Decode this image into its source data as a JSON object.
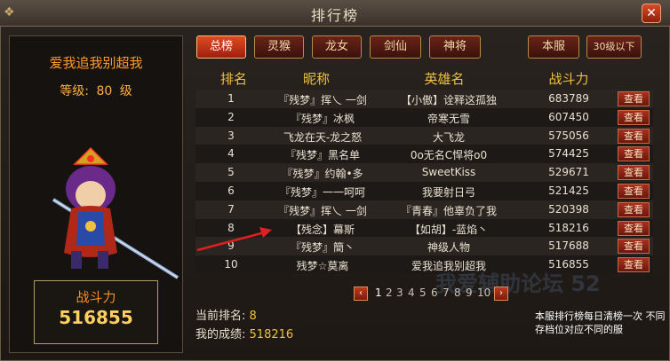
{
  "window": {
    "title": "排行榜",
    "close_label": "✕"
  },
  "hero": {
    "name": "爱我追我别超我",
    "level_label": "等级:",
    "level_value": "80",
    "level_suffix": "级",
    "power_label": "战斗力",
    "power_value": "516855"
  },
  "tabs": [
    {
      "label": "总榜",
      "active": true
    },
    {
      "label": "灵猴",
      "active": false
    },
    {
      "label": "龙女",
      "active": false
    },
    {
      "label": "剑仙",
      "active": false
    },
    {
      "label": "神将",
      "active": false
    },
    {
      "label": "本服",
      "active": false
    },
    {
      "label": "30级以下",
      "active": false
    }
  ],
  "table": {
    "headers": [
      "排名",
      "昵称",
      "英雄名",
      "战斗力"
    ],
    "view_label": "查看",
    "rows": [
      {
        "rank": "1",
        "nick": "『残梦』挥乀 一剑",
        "hero": "【小傲】诠释这孤独",
        "power": "683789"
      },
      {
        "rank": "2",
        "nick": "『残梦』冰枫",
        "hero": "帝寒无雪",
        "power": "607450"
      },
      {
        "rank": "3",
        "nick": "飞龙在天-龙之怒",
        "hero": "大飞龙",
        "power": "575056"
      },
      {
        "rank": "4",
        "nick": "『残梦』黑名单",
        "hero": "0o无名C悍将o0",
        "power": "574425"
      },
      {
        "rank": "5",
        "nick": "『残梦』约翰•多",
        "hero": "SweetKiss",
        "power": "529671"
      },
      {
        "rank": "6",
        "nick": "『残梦』一一呵呵",
        "hero": "我要射日弓",
        "power": "521425"
      },
      {
        "rank": "7",
        "nick": "『残梦』挥乀 一剑",
        "hero": "『青春』他辜负了我",
        "power": "520398"
      },
      {
        "rank": "8",
        "nick": "【残念】幕斯",
        "hero": "【如胡】-蓝焰丶",
        "power": "518216"
      },
      {
        "rank": "9",
        "nick": "『残梦』簡丶",
        "hero": "神级人物",
        "power": "517688"
      },
      {
        "rank": "10",
        "nick": "残梦☆莫离",
        "hero": "爱我追我别超我",
        "power": "516855"
      }
    ]
  },
  "pager": {
    "prev": "‹",
    "next": "›",
    "pages": [
      "1",
      "2",
      "3",
      "4",
      "5",
      "6",
      "7",
      "8",
      "9",
      "10"
    ],
    "current": "1"
  },
  "status": {
    "rank_label": "当前排名:",
    "rank_value": "8",
    "score_label": "我的成绩:",
    "score_value": "518216"
  },
  "note": "本服排行榜每日清榜一次 不同存档位对应不同的服",
  "watermark": "我爱辅助论坛 52"
}
